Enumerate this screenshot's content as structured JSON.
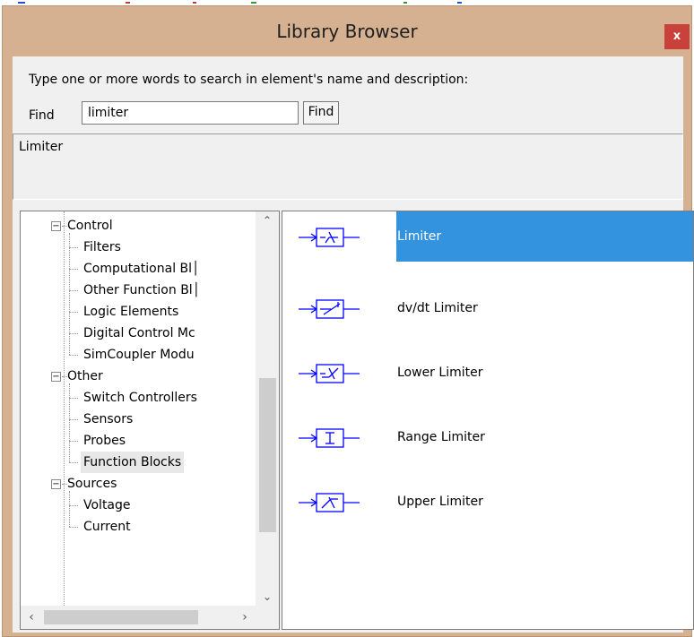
{
  "window": {
    "title": "Library Browser",
    "close_label": "x"
  },
  "search": {
    "prompt": "Type one or more words to search in element's name and  description:",
    "find_label": "Find",
    "value": "limiter",
    "button_label": "Find"
  },
  "description": {
    "text": "Limiter"
  },
  "tree": {
    "items": [
      {
        "label": "Control",
        "level": 0,
        "expander": "−"
      },
      {
        "label": "Filters",
        "level": 1
      },
      {
        "label": "Computational Bl│",
        "level": 1
      },
      {
        "label": "Other Function Bl│",
        "level": 1
      },
      {
        "label": "Logic Elements",
        "level": 1
      },
      {
        "label": "Digital Control Mc",
        "level": 1
      },
      {
        "label": "SimCoupler Modu",
        "level": 1
      },
      {
        "label": "Other",
        "level": 0,
        "expander": "−"
      },
      {
        "label": "Switch Controllers",
        "level": 1
      },
      {
        "label": "Sensors",
        "level": 1
      },
      {
        "label": "Probes",
        "level": 1
      },
      {
        "label": "Function Blocks",
        "level": 1,
        "selected": true
      },
      {
        "label": "Sources",
        "level": 0,
        "expander": "−"
      },
      {
        "label": "Voltage",
        "level": 1
      },
      {
        "label": "Current",
        "level": 1
      }
    ],
    "scroll_up_icon": "chevron-up-icon",
    "scroll_down_icon": "chevron-down-icon"
  },
  "list": {
    "items": [
      {
        "label": "Limiter",
        "icon": "limiter-icon",
        "selected": true
      },
      {
        "label": "dv/dt Limiter",
        "icon": "dvdt-limiter-icon"
      },
      {
        "label": "Lower Limiter",
        "icon": "lower-limiter-icon"
      },
      {
        "label": "Range Limiter",
        "icon": "range-limiter-icon"
      },
      {
        "label": "Upper Limiter",
        "icon": "upper-limiter-icon"
      }
    ]
  },
  "colors": {
    "title_bar": "#d5b091",
    "close_button": "#c8413a",
    "selection": "#3393df",
    "symbol_stroke": "#0000ff"
  }
}
